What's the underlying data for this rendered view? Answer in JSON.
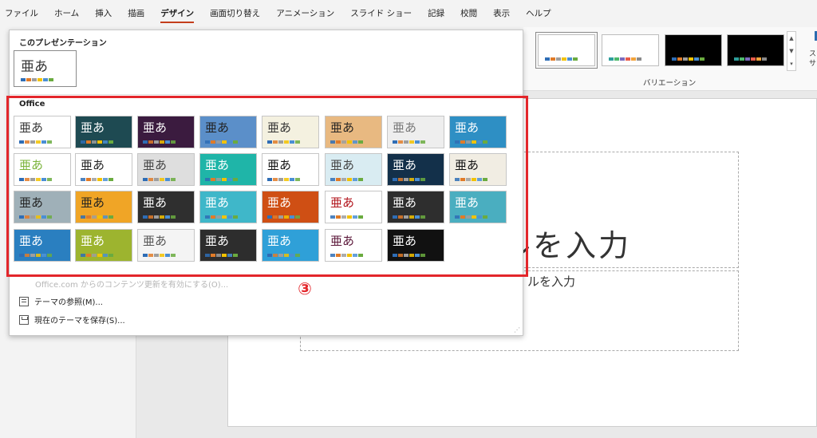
{
  "menu": [
    "ファイル",
    "ホーム",
    "挿入",
    "描画",
    "デザイン",
    "画面切り替え",
    "アニメーション",
    "スライド ショー",
    "記録",
    "校閲",
    "表示",
    "ヘルプ"
  ],
  "ribbon": {
    "variation_label": "バリエーション",
    "cut_text": "ス\nサ"
  },
  "gallery": {
    "current_heading": "このプレゼンテーション",
    "office_heading": "Office",
    "glyph": "亜あ",
    "disabled_link": "Office.com からのコンテンツ更新を有効にする(O)...",
    "browse_label": "テーマの参照(M)...",
    "save_label": "現在のテーマを保存(S)..."
  },
  "slide": {
    "title_placeholder": "ルを入力",
    "subtitle_placeholder": "ルを入力"
  },
  "annotation": {
    "number": "③"
  },
  "colors": {
    "highlight": "#e3262b",
    "active_tab_underline": "#c43e1c"
  },
  "themes": [
    {
      "bg": "#ffffff",
      "fg": "#333333"
    },
    {
      "bg": "#1e4a52",
      "fg": "#ffffff"
    },
    {
      "bg": "#3b1b3f",
      "fg": "#ffffff"
    },
    {
      "bg": "#5b8fc9",
      "fg": "#222222"
    },
    {
      "bg": "#f4f1e0",
      "fg": "#333333"
    },
    {
      "bg": "#e8b981",
      "fg": "#222222"
    },
    {
      "bg": "#eeeeee",
      "fg": "#777777"
    },
    {
      "bg": "#2e8fc4",
      "fg": "#ffffff"
    },
    {
      "bg": "#ffffff",
      "fg": "#7ab33a"
    },
    {
      "bg": "#ffffff",
      "fg": "#222222"
    },
    {
      "bg": "#dedede",
      "fg": "#444444"
    },
    {
      "bg": "#1fb5a8",
      "fg": "#ffffff"
    },
    {
      "bg": "#ffffff",
      "fg": "#111111"
    },
    {
      "bg": "#d9ecf2",
      "fg": "#444444"
    },
    {
      "bg": "#13304a",
      "fg": "#ffffff"
    },
    {
      "bg": "#f1ede3",
      "fg": "#111111"
    },
    {
      "bg": "#9fb0b8",
      "fg": "#222222"
    },
    {
      "bg": "#f0a526",
      "fg": "#222222"
    },
    {
      "bg": "#2f2f2f",
      "fg": "#ffffff"
    },
    {
      "bg": "#3fb7c9",
      "fg": "#ffffff"
    },
    {
      "bg": "#cf4f14",
      "fg": "#ffffff"
    },
    {
      "bg": "#ffffff",
      "fg": "#b1121a"
    },
    {
      "bg": "#2e2e2e",
      "fg": "#ffffff"
    },
    {
      "bg": "#4aaec0",
      "fg": "#ffffff"
    },
    {
      "bg": "#2a7fc0",
      "fg": "#ffffff"
    },
    {
      "bg": "#9db42f",
      "fg": "#ffffff"
    },
    {
      "bg": "#f4f4f4",
      "fg": "#555555"
    },
    {
      "bg": "#2d2d2d",
      "fg": "#ffffff"
    },
    {
      "bg": "#2fa0d8",
      "fg": "#ffffff"
    },
    {
      "bg": "#ffffff",
      "fg": "#5a1638"
    },
    {
      "bg": "#111111",
      "fg": "#ffffff"
    }
  ],
  "palette": [
    "#2f6db5",
    "#e07b28",
    "#9e9e9e",
    "#f2c200",
    "#4a8fd4",
    "#6aab3f"
  ]
}
